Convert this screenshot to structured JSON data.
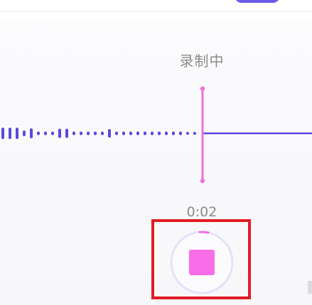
{
  "recorder": {
    "status_label": "录制中",
    "elapsed_time": "0:02",
    "waveform_color": "#5b48de",
    "playhead_color": "#f06ee2",
    "stop_button_color": "#f86ee9",
    "highlight_color": "#e21c25"
  }
}
